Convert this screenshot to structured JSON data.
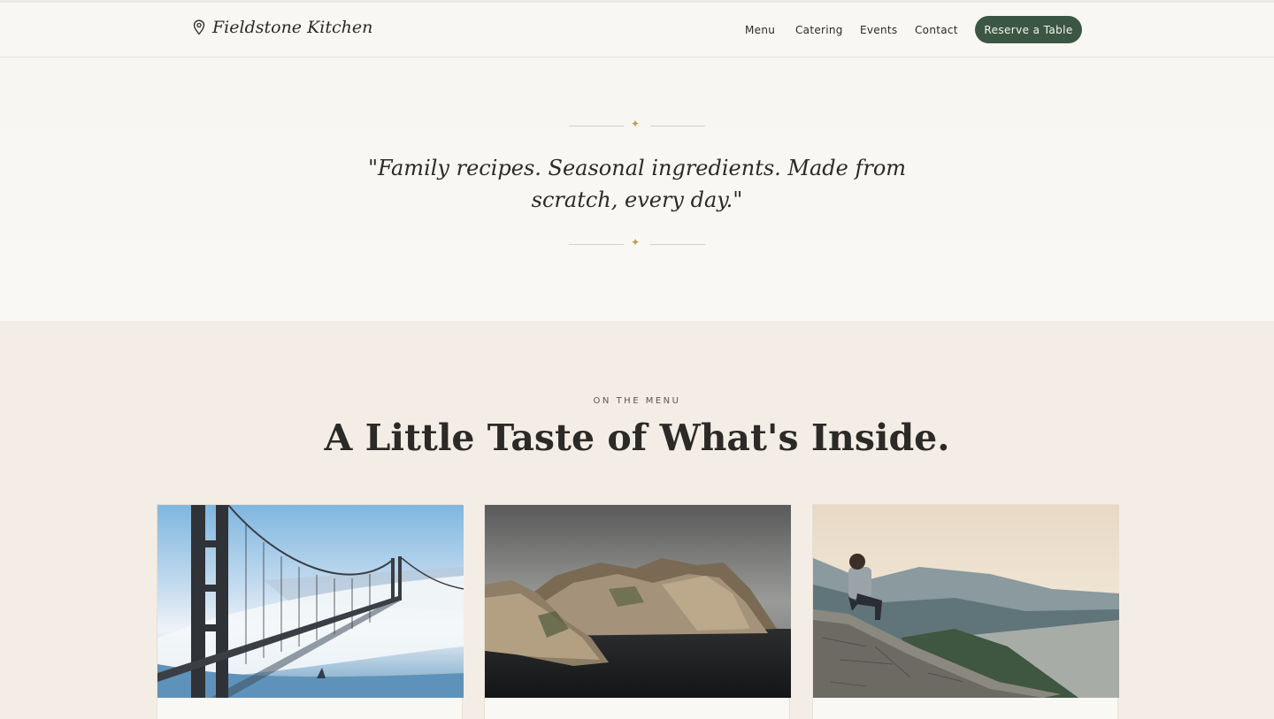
{
  "brand": {
    "name": "Fieldstone Kitchen",
    "icon": "map-pin-icon"
  },
  "nav": {
    "links": [
      "Menu",
      "Catering",
      "Events",
      "Contact"
    ],
    "cta": "Reserve a Table"
  },
  "quote": {
    "text": "\"Family recipes. Seasonal ingredients. Made from scratch, every day.\""
  },
  "menu_section": {
    "eyebrow": "ON THE MENU",
    "heading": "A Little Taste of What's Inside."
  },
  "cards": [
    {
      "image": "bridge-in-fog-photo"
    },
    {
      "image": "rocky-coastline-photo"
    },
    {
      "image": "man-on-wall-overlook-photo"
    }
  ],
  "colors": {
    "accent_green": "#3b5744",
    "gold_ornament": "#c49a52",
    "page_bg": "#f7f3ee",
    "section_bg": "#f4ede6"
  }
}
